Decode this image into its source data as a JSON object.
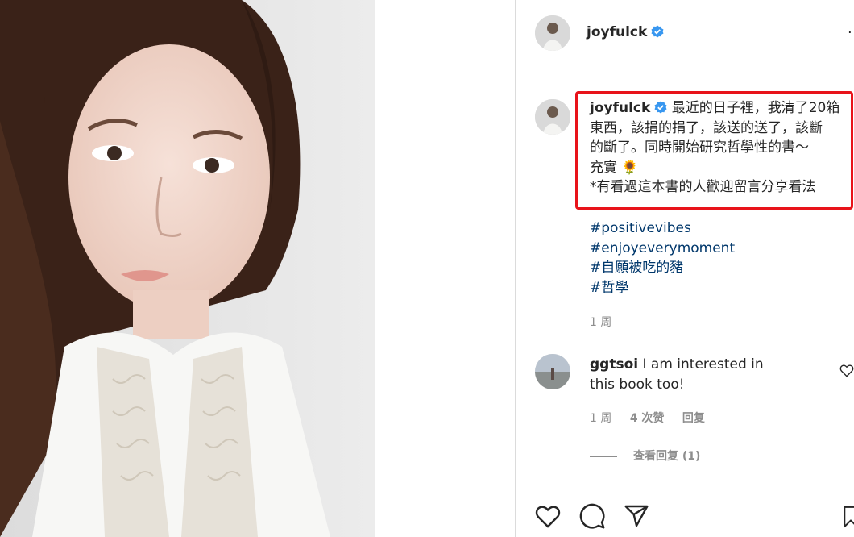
{
  "post": {
    "username": "joyfulck",
    "more_label": "···",
    "caption_lines": [
      "最近的日子裡，我清了20箱",
      "東西，該捐的捐了，該送的送了，該斷",
      "的斷了。同時開始研究哲學性的書～",
      "充實 🌻",
      "*有看過這本書的人歡迎留言分享看法"
    ],
    "hashtags": [
      "#positivevibes",
      "#enjoyeverymoment",
      "#自願被吃的豬",
      "#哲學"
    ],
    "timestamp": "1 周"
  },
  "comment": {
    "username": "ggtsoi",
    "text": "I am interested in this book too!",
    "timestamp": "1 周",
    "likes": "4 次赞",
    "reply_label": "回复",
    "view_replies": "查看回复 (1)"
  },
  "colors": {
    "highlight_border": "#e8131a",
    "verified_badge": "#3897f0",
    "hashtag": "#00376b",
    "muted": "#8e8e8e"
  },
  "icons": [
    "verified-badge-icon",
    "heart-icon",
    "comment-icon",
    "share-icon",
    "bookmark-icon",
    "comment-like-icon"
  ]
}
